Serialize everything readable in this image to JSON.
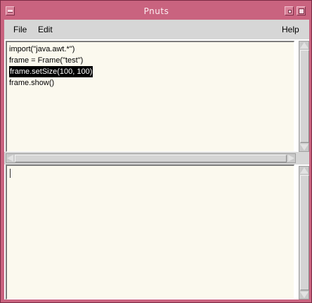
{
  "window": {
    "title": "Pnuts"
  },
  "menubar": {
    "file_label": "File",
    "edit_label": "Edit",
    "help_label": "Help"
  },
  "editor": {
    "lines": [
      "import(\"java.awt.*\")",
      "frame = Frame(\"test\")",
      "frame.setSize(100, 100)",
      "frame.show()"
    ],
    "selected_line_index": 2
  },
  "output": {
    "text": ""
  },
  "colors": {
    "window_frame": "#c9637f",
    "pane_background": "#fbf9ee",
    "menubar_background": "#d6d6d6",
    "selection_background": "#000000"
  },
  "icons": [
    "window-menu-icon",
    "minimize-icon",
    "maximize-icon"
  ]
}
